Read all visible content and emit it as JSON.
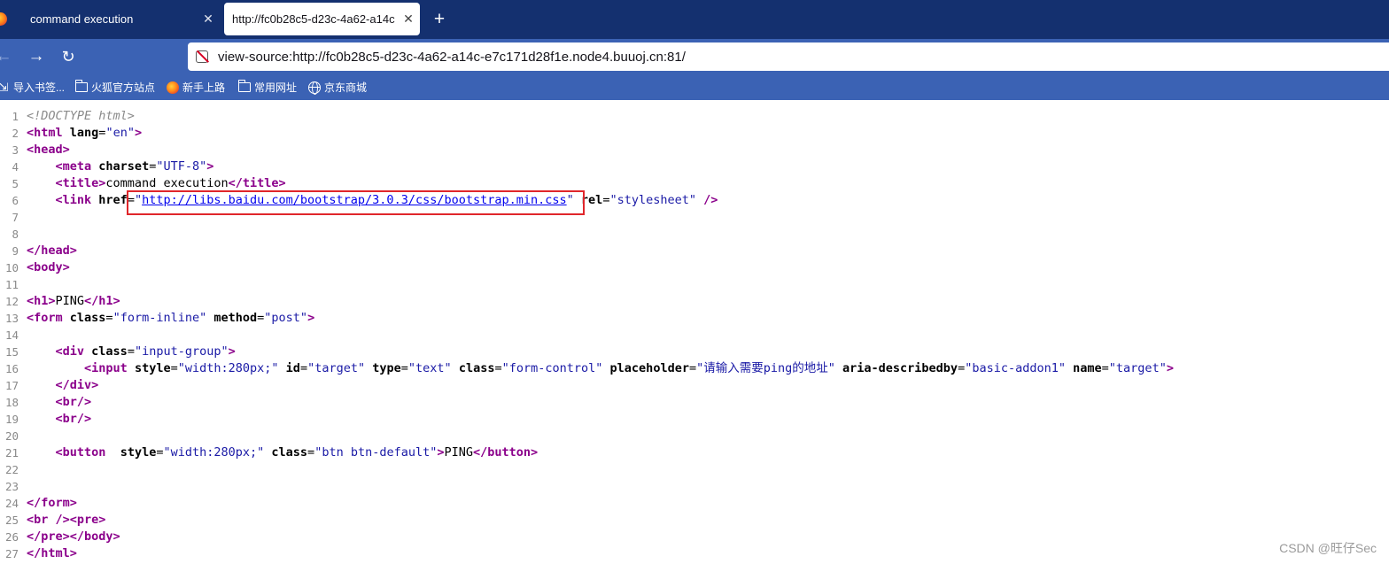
{
  "browser": {
    "tabs": [
      {
        "label": "command execution",
        "active": false
      },
      {
        "label": "http://fc0b28c5-d23c-4a62-a14c",
        "active": true
      }
    ],
    "close_glyph": "✕",
    "new_tab_glyph": "+",
    "nav": {
      "back": "←",
      "forward": "→",
      "reload": "↻"
    },
    "url": "view-source:http://fc0b28c5-d23c-4a62-a14c-e7c171d28f1e.node4.buuoj.cn:81/",
    "bookmarks": [
      {
        "label": "导入书签...",
        "icon": "import-icon"
      },
      {
        "label": "火狐官方站点",
        "icon": "folder-icon"
      },
      {
        "label": "新手上路",
        "icon": "firefox-icon"
      },
      {
        "label": "常用网址",
        "icon": "folder-icon"
      },
      {
        "label": "京东商城",
        "icon": "globe-icon"
      }
    ]
  },
  "source": {
    "line_numbers": [
      "1",
      "2",
      "3",
      "4",
      "5",
      "6",
      "7",
      "8",
      "9",
      "10",
      "11",
      "12",
      "13",
      "14",
      "15",
      "16",
      "17",
      "18",
      "19",
      "20",
      "21",
      "22",
      "23",
      "24",
      "25",
      "26",
      "27"
    ],
    "l1": "<!DOCTYPE html>",
    "l2_tag": "<html",
    "l2_attr": "lang",
    "l2_val": "\"en\"",
    "l2_end": ">",
    "l3": "<head>",
    "l4_tag": "<meta",
    "l4_attr": "charset",
    "l4_val": "\"UTF-8\"",
    "l4_end": ">",
    "l5_open": "<title>",
    "l5_text": "command execution",
    "l5_close": "</title>",
    "l6_tag": "<link",
    "l6_attr1": "href",
    "l6_link": "http://libs.baidu.com/bootstrap/3.0.3/css/bootstrap.min.css",
    "l6_attr2": "rel",
    "l6_val2": "\"stylesheet\"",
    "l6_end": " />",
    "l9": "</head>",
    "l10": "<body>",
    "l12_open": "<h1>",
    "l12_text": "PING",
    "l12_close": "</h1>",
    "l13_tag": "<form",
    "l13_attr1": "class",
    "l13_val1": "\"form-inline\"",
    "l13_attr2": "method",
    "l13_val2": "\"post\"",
    "l13_end": ">",
    "l15_tag": "<div",
    "l15_attr": "class",
    "l15_val": "\"input-group\"",
    "l15_end": ">",
    "l16_tag": "<input",
    "l16_a1": "style",
    "l16_v1": "\"width:280px;\"",
    "l16_a2": "id",
    "l16_v2": "\"target\"",
    "l16_a3": "type",
    "l16_v3": "\"text\"",
    "l16_a4": "class",
    "l16_v4": "\"form-control\"",
    "l16_a5": "placeholder",
    "l16_v5": "\"请输入需要ping的地址\"",
    "l16_a6": "aria-describedby",
    "l16_v6": "\"basic-addon1\"",
    "l16_a7": "name",
    "l16_v7": "\"target\"",
    "l16_end": ">",
    "l17": "</div>",
    "l18": "<br/>",
    "l19": "<br/>",
    "l21_tag": "<button",
    "l21_a1": "style",
    "l21_v1": "\"width:280px;\"",
    "l21_a2": "class",
    "l21_v2": "\"btn btn-default\"",
    "l21_end": ">",
    "l21_text": "PING",
    "l21_close": "</button>",
    "l24": "</form>",
    "l25_a": "<br />",
    "l25_b": "<pre>",
    "l26_a": "</pre>",
    "l26_b": "</body>",
    "l27": "</html>"
  },
  "watermark": "CSDN @旺仔Sec",
  "colors": {
    "tabstrip": "#14306f",
    "toolbar": "#3b62b4",
    "highlight": "#e0262b",
    "tag": "#8b008b",
    "value": "#1a1aa6"
  }
}
